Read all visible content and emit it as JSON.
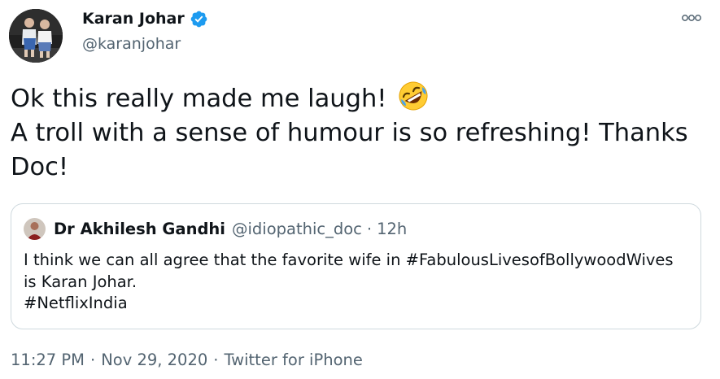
{
  "author": {
    "display_name": "Karan Johar",
    "handle": "@karanjohar",
    "verified_icon": "verified-badge-icon",
    "avatar_icon": "profile-photo-twins"
  },
  "menu": {
    "more_icon": "more-options-icon"
  },
  "tweet": {
    "lines": [
      "Ok this really made me laugh!",
      "A troll with a sense of humour is so refreshing! Thanks",
      "Doc!"
    ],
    "emoji_icon": "rolling-on-floor-laughing-emoji"
  },
  "quoted_tweet": {
    "display_name": "Dr Akhilesh Gandhi",
    "handle": "@idiopathic_doc",
    "separator": "·",
    "time": "12h",
    "lines": [
      "I think we can all agree that the favorite wife in #FabulousLivesofBollywoodWives",
      "is Karan Johar.",
      "#NetflixIndia"
    ]
  },
  "footer": {
    "time": "11:27 PM",
    "date": "Nov 29, 2020",
    "source": "Twitter for iPhone",
    "separator": "·"
  },
  "colors": {
    "text_primary": "#0f1419",
    "text_secondary": "#536471",
    "verified_blue": "#1d9bf0",
    "border": "#cfd9de"
  }
}
